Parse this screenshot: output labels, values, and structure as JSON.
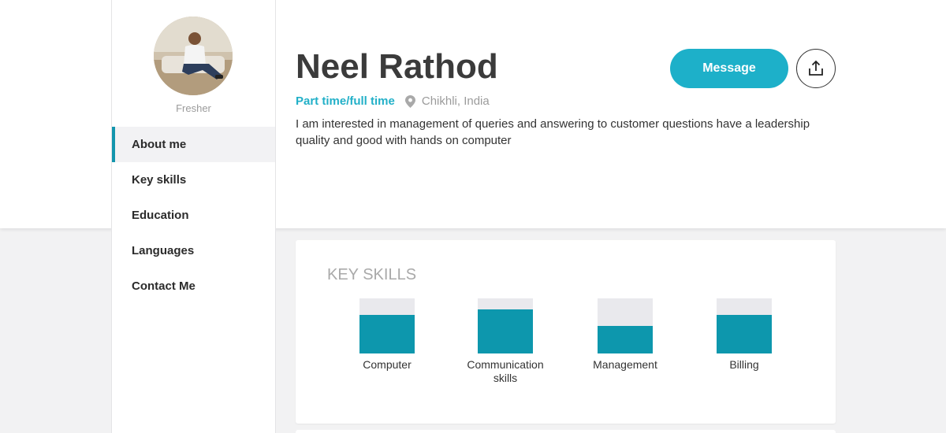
{
  "profile": {
    "name": "Neel Rathod",
    "status": "Fresher",
    "job_type": "Part time/full time",
    "location": "Chikhli, India",
    "bio": "I am interested in management of queries and answering to customer questions have a leadership quality and good with hands on computer",
    "avatar_icon": "profile-photo"
  },
  "actions": {
    "message_label": "Message",
    "share_icon": "share-icon"
  },
  "nav": {
    "items": [
      {
        "label": "About me",
        "active": true
      },
      {
        "label": "Key skills",
        "active": false
      },
      {
        "label": "Education",
        "active": false
      },
      {
        "label": "Languages",
        "active": false
      },
      {
        "label": "Contact Me",
        "active": false
      }
    ]
  },
  "key_skills": {
    "title": "KEY SKILLS",
    "skills": [
      {
        "label": "Computer",
        "level": 0.7
      },
      {
        "label": "Communication skills",
        "level": 0.8
      },
      {
        "label": "Management",
        "level": 0.5
      },
      {
        "label": "Billing",
        "level": 0.7
      }
    ]
  },
  "colors": {
    "accent": "#1db0c9",
    "bar_fill": "#0d97ad",
    "bar_track": "#e9e9ed"
  }
}
